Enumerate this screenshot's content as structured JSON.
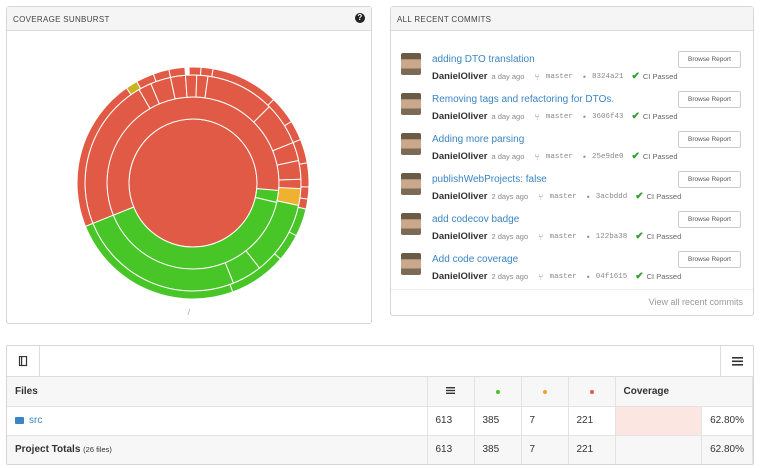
{
  "sunburst": {
    "title": "COVERAGE SUNBURST",
    "caption": "/",
    "colors": {
      "red": "#e05a45",
      "green": "#48c628",
      "yellow": "#c7b420",
      "orange": "#f0b030"
    }
  },
  "commits": {
    "title": "ALL RECENT COMMITS",
    "view_all": "View all recent commits",
    "items": [
      {
        "message": "adding DTO translation",
        "author": "DanielOliver",
        "time": "a day ago",
        "branch": "master",
        "sha": "8324a21",
        "ci": "CI Passed",
        "button": "Browse Report"
      },
      {
        "message": "Removing tags and refactoring for DTOs.",
        "author": "DanielOliver",
        "time": "a day ago",
        "branch": "master",
        "sha": "3606f43",
        "ci": "CI Passed",
        "button": "Browse Report"
      },
      {
        "message": "Adding more parsing",
        "author": "DanielOliver",
        "time": "a day ago",
        "branch": "master",
        "sha": "25e9de0",
        "ci": "CI Passed",
        "button": "Browse Report"
      },
      {
        "message": "publishWebProjects: false",
        "author": "DanielOliver",
        "time": "2 days ago",
        "branch": "master",
        "sha": "3acbddd",
        "ci": "CI Passed",
        "button": "Browse Report"
      },
      {
        "message": "add codecov badge",
        "author": "DanielOliver",
        "time": "2 days ago",
        "branch": "master",
        "sha": "122ba38",
        "ci": "CI Passed",
        "button": "Browse Report"
      },
      {
        "message": "Add code coverage",
        "author": "DanielOliver",
        "time": "2 days ago",
        "branch": "master",
        "sha": "04f1615",
        "ci": "CI Passed",
        "button": "Browse Report"
      }
    ]
  },
  "table": {
    "headers": {
      "files": "Files",
      "coverage": "Coverage"
    },
    "dot_colors": {
      "hit": "#48c628",
      "partial": "#f0a030",
      "miss": "#e05a45"
    },
    "rows": [
      {
        "name": "src",
        "lines": "613",
        "hits": "385",
        "partials": "7",
        "misses": "221",
        "coverage": "62.80%"
      }
    ],
    "totals": {
      "label": "Project Totals",
      "files": "(26 files)",
      "lines": "613",
      "hits": "385",
      "partials": "7",
      "misses": "221",
      "coverage": "62.80%"
    }
  }
}
